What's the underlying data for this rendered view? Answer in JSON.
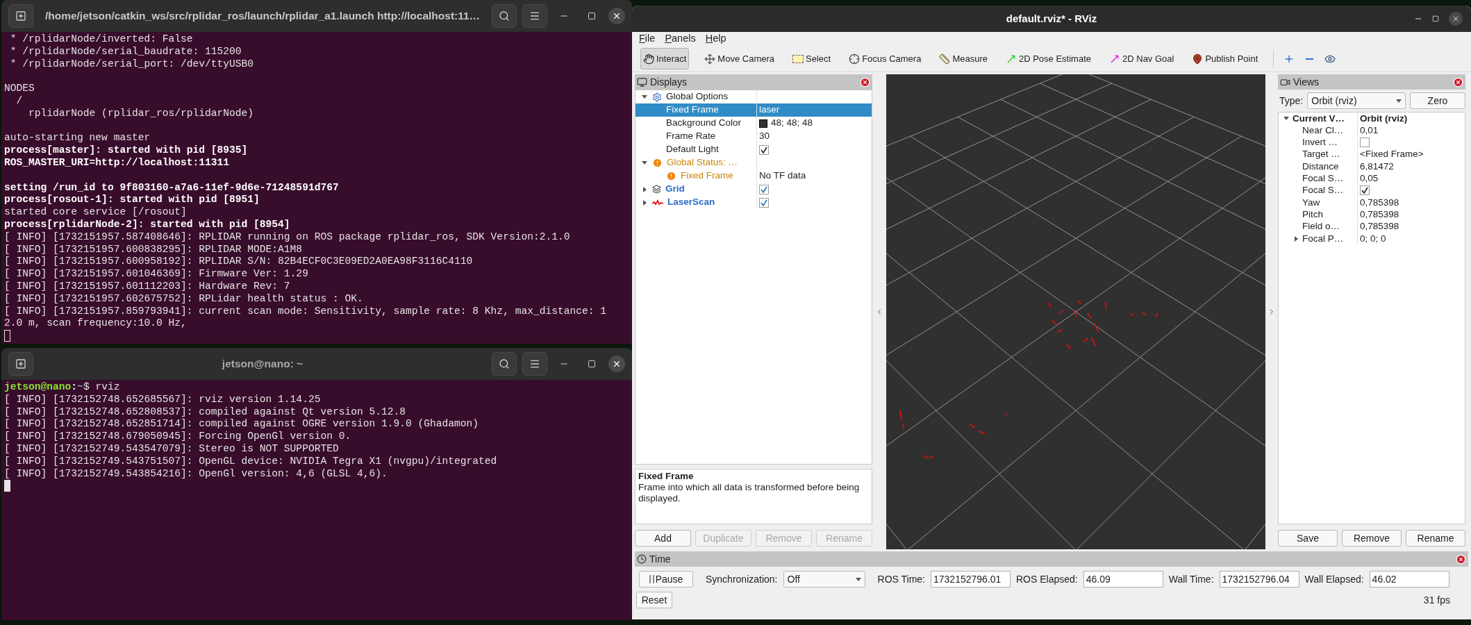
{
  "terminals": [
    {
      "title": "/home/jetson/catkin_ws/src/rplidar_ros/launch/rplidar_a1.launch http://localhost:11…",
      "focused": false,
      "lines": [
        {
          "kind": "text",
          "text": " * /rplidarNode/inverted: False",
          "bold": false,
          "gap_before": false
        },
        {
          "kind": "text",
          "text": " * /rplidarNode/serial_baudrate: 115200",
          "bold": false,
          "gap_before": false
        },
        {
          "kind": "text",
          "text": " * /rplidarNode/serial_port: /dev/ttyUSB0",
          "bold": false,
          "gap_before": false
        },
        {
          "kind": "text",
          "text": "NODES",
          "bold": false,
          "gap_before": true
        },
        {
          "kind": "text",
          "text": "  /",
          "bold": false,
          "gap_before": false
        },
        {
          "kind": "text",
          "text": "    rplidarNode (rplidar_ros/rplidarNode)",
          "bold": false,
          "gap_before": false
        },
        {
          "kind": "text",
          "text": "auto-starting new master",
          "bold": false,
          "gap_before": true
        },
        {
          "kind": "text",
          "text": "process[master]: started with pid [8935]",
          "bold": true,
          "gap_before": false
        },
        {
          "kind": "text",
          "text": "ROS_MASTER_URI=http://localhost:11311",
          "bold": true,
          "gap_before": false
        },
        {
          "kind": "text",
          "text": "setting /run_id to 9f803160-a7a6-11ef-9d6e-71248591d767",
          "bold": true,
          "gap_before": true
        },
        {
          "kind": "text",
          "text": "process[rosout-1]: started with pid [8951]",
          "bold": true,
          "gap_before": false
        },
        {
          "kind": "text",
          "text": "started core service [/rosout]",
          "bold": false,
          "gap_before": false
        },
        {
          "kind": "text",
          "text": "process[rplidarNode-2]: started with pid [8954]",
          "bold": true,
          "gap_before": false
        },
        {
          "kind": "text",
          "text": "[ INFO] [1732151957.587408646]: RPLIDAR running on ROS package rplidar_ros, SDK Version:2.1.0",
          "bold": false,
          "gap_before": false
        },
        {
          "kind": "text",
          "text": "[ INFO] [1732151957.600838295]: RPLIDAR MODE:A1M8",
          "bold": false,
          "gap_before": false
        },
        {
          "kind": "text",
          "text": "[ INFO] [1732151957.600958192]: RPLIDAR S/N: 82B4ECF0C3E09ED2A0EA98F3116C4110",
          "bold": false,
          "gap_before": false
        },
        {
          "kind": "text",
          "text": "[ INFO] [1732151957.601046369]: Firmware Ver: 1.29",
          "bold": false,
          "gap_before": false
        },
        {
          "kind": "text",
          "text": "[ INFO] [1732151957.601112203]: Hardware Rev: 7",
          "bold": false,
          "gap_before": false
        },
        {
          "kind": "text",
          "text": "[ INFO] [1732151957.602675752]: RPLidar health status : OK.",
          "bold": false,
          "gap_before": false
        },
        {
          "kind": "text",
          "text": "[ INFO] [1732151957.859793941]: current scan mode: Sensitivity, sample rate: 8 Khz, max_distance: 1",
          "bold": false,
          "gap_before": false
        },
        {
          "kind": "text",
          "text": "2.0 m, scan frequency:10.0 Hz,",
          "bold": false,
          "gap_before": false
        }
      ]
    },
    {
      "title": "jetson@nano: ~",
      "focused": true,
      "lines": [
        {
          "kind": "prompt",
          "user_host": "jetson@nano",
          "separator": ":",
          "path": "~",
          "command": "$ rviz",
          "gap_before": false
        },
        {
          "kind": "text",
          "text": "[ INFO] [1732152748.652685567]: rviz version 1.14.25",
          "bold": false,
          "gap_before": false
        },
        {
          "kind": "text",
          "text": "[ INFO] [1732152748.652808537]: compiled against Qt version 5.12.8",
          "bold": false,
          "gap_before": false
        },
        {
          "kind": "text",
          "text": "[ INFO] [1732152748.652851714]: compiled against OGRE version 1.9.0 (Ghadamon)",
          "bold": false,
          "gap_before": false
        },
        {
          "kind": "text",
          "text": "[ INFO] [1732152748.679050945]: Forcing OpenGl version 0.",
          "bold": false,
          "gap_before": false
        },
        {
          "kind": "text",
          "text": "[ INFO] [1732152749.543547079]: Stereo is NOT SUPPORTED",
          "bold": false,
          "gap_before": false
        },
        {
          "kind": "text",
          "text": "[ INFO] [1732152749.543751507]: OpenGL device: NVIDIA Tegra X1 (nvgpu)/integrated",
          "bold": false,
          "gap_before": false
        },
        {
          "kind": "text",
          "text": "[ INFO] [1732152749.543854216]: OpenGl version: 4,6 (GLSL 4,6).",
          "bold": false,
          "gap_before": false
        }
      ]
    }
  ],
  "rviz": {
    "title": "default.rviz* - RViz",
    "menu": [
      "File",
      "Panels",
      "Help"
    ],
    "tools": [
      {
        "kind": "interact",
        "label": "Interact",
        "selected": true
      },
      {
        "kind": "move_camera",
        "label": "Move Camera",
        "selected": false
      },
      {
        "kind": "select",
        "label": "Select",
        "selected": false
      },
      {
        "kind": "focus_camera",
        "label": "Focus Camera",
        "selected": false
      },
      {
        "kind": "measure",
        "label": "Measure",
        "selected": false
      },
      {
        "kind": "pose_estimate",
        "label": "2D Pose Estimate",
        "selected": false
      },
      {
        "kind": "nav_goal",
        "label": "2D Nav Goal",
        "selected": false
      },
      {
        "kind": "publish_point",
        "label": "Publish Point",
        "selected": false
      }
    ],
    "displays": {
      "title": "Displays",
      "items": [
        {
          "kind": "options",
          "label": "Global Options",
          "expanded": true,
          "selected": false,
          "children": [
            {
              "kind": "property",
              "label": "Fixed Frame",
              "value": "laser",
              "selected": true
            },
            {
              "kind": "color",
              "label": "Background Color",
              "value": "48; 48; 48",
              "selected": false
            },
            {
              "kind": "property",
              "label": "Frame Rate",
              "value": "30",
              "selected": false
            },
            {
              "kind": "checkbox",
              "label": "Default Light",
              "checked": true,
              "selected": false
            }
          ]
        },
        {
          "kind": "status",
          "label": "Global Status: …",
          "expanded": true,
          "selected": false,
          "children": [
            {
              "kind": "status",
              "label": "Fixed Frame",
              "value": "No TF data",
              "selected": false
            }
          ]
        },
        {
          "kind": "grid",
          "label": "Grid",
          "expanded": false,
          "checked": true,
          "selected": false
        },
        {
          "kind": "laser_scan",
          "label": "LaserScan",
          "expanded": false,
          "checked": true,
          "selected": false
        }
      ],
      "description": {
        "title": "Fixed Frame",
        "text": "Frame into which all data is transformed before being displayed."
      },
      "buttons": [
        {
          "label": "Add",
          "disabled": false
        },
        {
          "label": "Duplicate",
          "disabled": true
        },
        {
          "label": "Remove",
          "disabled": true
        },
        {
          "label": "Rename",
          "disabled": true
        }
      ]
    },
    "views": {
      "title": "Views",
      "type_label": "Type:",
      "type_value": "Orbit (rviz)",
      "zero_button": "Zero",
      "items": [
        {
          "kind": "header",
          "label": "Current V…",
          "value": "Orbit (rviz)",
          "expanded": true,
          "children": [
            {
              "kind": "property",
              "label": "Near Cl…",
              "value": "0,01"
            },
            {
              "kind": "checkbox",
              "label": "Invert …",
              "checked": false
            },
            {
              "kind": "property",
              "label": "Target …",
              "value": "<Fixed Frame>"
            },
            {
              "kind": "property",
              "label": "Distance",
              "value": "6,81472"
            },
            {
              "kind": "property",
              "label": "Focal S…",
              "value": "0,05"
            },
            {
              "kind": "checkbox",
              "label": "Focal S…",
              "checked": true
            },
            {
              "kind": "property",
              "label": "Yaw",
              "value": "0,785398"
            },
            {
              "kind": "property",
              "label": "Pitch",
              "value": "0,785398"
            },
            {
              "kind": "property",
              "label": "Field o…",
              "value": "0,785398"
            },
            {
              "kind": "group",
              "label": "Focal P…",
              "value": "0; 0; 0",
              "expanded": false
            }
          ]
        }
      ],
      "buttons": [
        "Save",
        "Remove",
        "Rename"
      ]
    },
    "time": {
      "title": "Time",
      "pause_button": "Pause",
      "sync_label": "Synchronization:",
      "sync_value": "Off",
      "fields": [
        {
          "label": "ROS Time:",
          "value": "1732152796.01"
        },
        {
          "label": "ROS Elapsed:",
          "value": "46.09"
        },
        {
          "label": "Wall Time:",
          "value": "1732152796.04"
        },
        {
          "label": "Wall Elapsed:",
          "value": "46.02"
        }
      ],
      "reset_button": "Reset",
      "fps": "31 fps"
    }
  }
}
